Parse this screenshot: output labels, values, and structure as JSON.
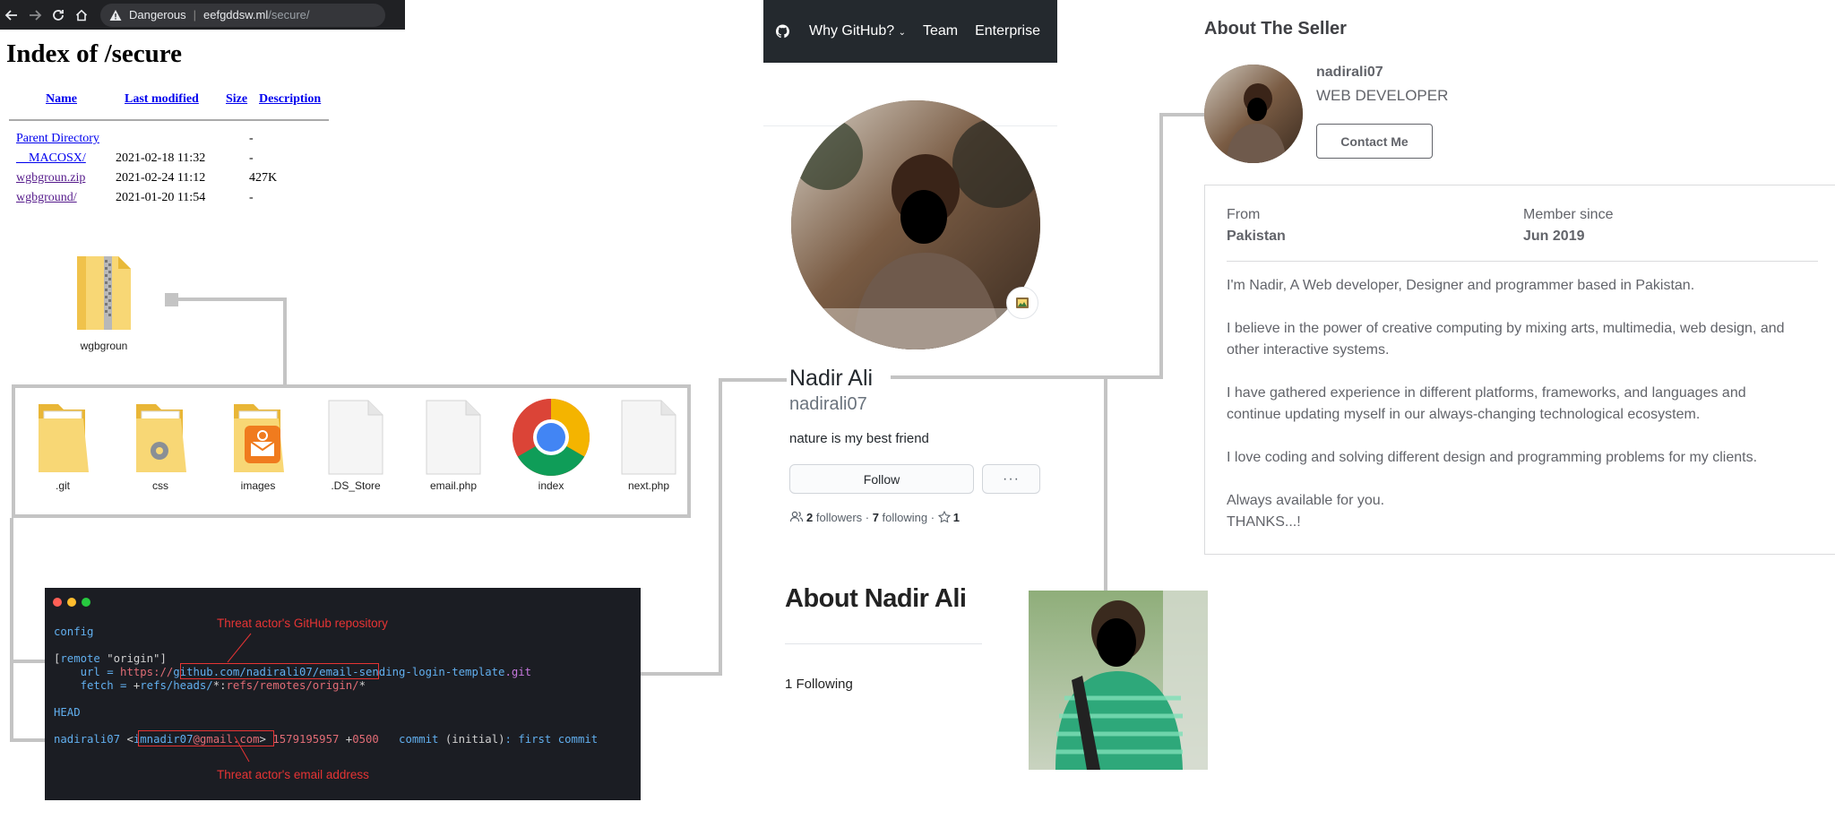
{
  "browser": {
    "security_label": "Dangerous",
    "url_host": "eefgddsw.ml",
    "url_path": "/secure/"
  },
  "directory": {
    "title": "Index of /secure",
    "columns": [
      "Name",
      "Last modified",
      "Size",
      "Description"
    ],
    "rows": [
      {
        "name": "Parent Directory",
        "modified": "",
        "size": "-"
      },
      {
        "name": "__MACOSX/",
        "modified": "2021-02-18 11:32",
        "size": "-"
      },
      {
        "name": "wgbgroun.zip",
        "modified": "2021-02-24 11:12",
        "size": "427K"
      },
      {
        "name": "wgbground/",
        "modified": "2021-01-20 11:54",
        "size": "-"
      }
    ]
  },
  "zip_file": {
    "label": "wgbgroun",
    "icon": "zip-folder-icon"
  },
  "folder_contents": [
    {
      "label": ".git",
      "icon": "folder-icon"
    },
    {
      "label": "css",
      "icon": "gear-folder-icon"
    },
    {
      "label": "images",
      "icon": "mail-folder-icon"
    },
    {
      "label": ".DS_Store",
      "icon": "blank-file-icon"
    },
    {
      "label": "email.php",
      "icon": "blank-file-icon"
    },
    {
      "label": "index",
      "icon": "chrome-icon"
    },
    {
      "label": "next.php",
      "icon": "blank-file-icon"
    }
  ],
  "terminal": {
    "config": "config",
    "remote_open": "[",
    "remote_kw": "remote",
    "remote_name": " \"origin\"",
    "remote_close": "]",
    "url_key": "url = ",
    "url_scheme": "https://",
    "url_host": "github.com",
    "url_user": "/nadirali07",
    "url_rest": "/email-sending-login-template",
    "url_ext": ".git",
    "fetch_key": "fetch = ",
    "fetch_plus": "+",
    "fetch_refs": "refs/heads/",
    "fetch_star": "*",
    "fetch_colon": ":",
    "fetch_remote": "refs/remotes/origin/",
    "fetch_star2": "*",
    "head": "HEAD",
    "log_user": "nadirali07",
    "log_lt": " <",
    "log_email_user": "imnadir07",
    "log_email_domain": "@gmail.com",
    "log_gt": ">",
    "log_ts": " 1579195957",
    "log_tz_plus": " +",
    "log_tz": "0500",
    "log_commit": "   commit ",
    "log_paren": "(initial)",
    "log_msg": ": first commit",
    "annotation_repo": "Threat actor's GitHub repository",
    "annotation_email": "Threat actor's email address"
  },
  "github": {
    "nav": [
      "Why GitHub?",
      "Team",
      "Enterprise"
    ],
    "name": "Nadir Ali",
    "login": "nadirali07",
    "bio": "nature is my best friend",
    "follow_label": "Follow",
    "more_label": "···",
    "followers_count": "2",
    "followers_label": " followers · ",
    "following_count": "7",
    "following_label": " following · ",
    "stars_count": "1",
    "about_heading": "About Nadir Ali",
    "following_text": "1 Following"
  },
  "seller": {
    "title": "About The Seller",
    "username": "nadirali07",
    "role": "WEB DEVELOPER",
    "contact_label": "Contact Me",
    "from_label": "From",
    "from_value": "Pakistan",
    "member_label": "Member since",
    "member_value": "Jun 2019",
    "paragraphs": [
      "I'm Nadir, A Web developer, Designer and programmer based in Pakistan.",
      "I believe in the power of creative computing by mixing arts, multimedia, web design, and other interactive systems.",
      "I have gathered experience in different platforms, frameworks, and languages and continue updating myself in our always-changing technological ecosystem.",
      "I love coding and solving different design and programming problems for my clients.",
      "Always available for you.",
      "THANKS...!"
    ]
  },
  "colors": {
    "connector": "#c4c4c4",
    "annotation": "#e63434",
    "terminal_bg": "#1b1d23",
    "github_header": "#24292e"
  }
}
